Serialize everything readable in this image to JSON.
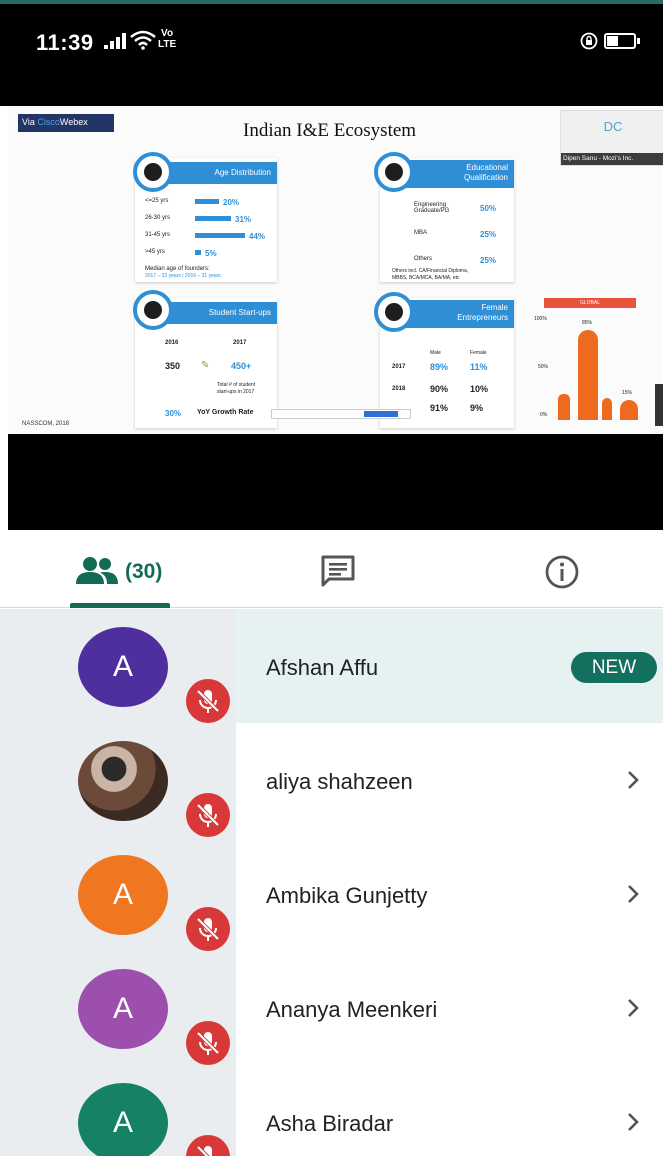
{
  "status_bar": {
    "time": "11:39",
    "network_badge_top": "Vo",
    "network_badge_bottom": "LTE",
    "icons": [
      "signal-icon",
      "wifi-icon",
      "rotation-lock-icon",
      "battery-icon"
    ]
  },
  "slide": {
    "webex_tag_prefix": "Via ",
    "webex_tag_brand": "Cisco",
    "webex_tag_suffix": "Webex",
    "title": "Indian I&E Ecosystem",
    "presenter_initials": "DC",
    "presenter_name": "Dipen Sanu - Mozi's Inc.",
    "age_distribution": {
      "heading": "Age Distribution",
      "rows": [
        {
          "label": "<=25 yrs",
          "value": "20%"
        },
        {
          "label": "26-30 yrs",
          "value": "31%"
        },
        {
          "label": "31-45 yrs",
          "value": "44%"
        },
        {
          "label": ">45 yrs",
          "value": "5%"
        }
      ],
      "bar_fractions": [
        0.2,
        0.31,
        0.44,
        0.05
      ],
      "note": "Median age of founders:",
      "note2": "2017 – 32 years | 2016 – 31 years"
    },
    "educational": {
      "heading_line1": "Educational",
      "heading_line2": "Qualification",
      "rows": [
        {
          "label": "Engineering Graduate/PG",
          "value": "50%"
        },
        {
          "label": "MBA",
          "value": "25%"
        },
        {
          "label": "Others",
          "value": "25%"
        }
      ],
      "note": "Others incl. CA/Financial Diploma,",
      "note2": "MBBS, BCA/MCA, BA/MA, etc"
    },
    "startups": {
      "heading": "Student Start-ups",
      "year1": "2016",
      "year2": "2017",
      "value1": "350",
      "value2": "450+",
      "note": "Total # of student",
      "note2": "start-ups in 2017",
      "growth_value": "30%",
      "growth_label": "YoY Growth Rate"
    },
    "female": {
      "heading_line1": "Female",
      "heading_line2": "Entrepreneurs",
      "col_male": "Male",
      "col_female": "Female",
      "rows": [
        {
          "year": "2017",
          "male": "89%",
          "female": "11%"
        },
        {
          "year": "2018",
          "male": "90%",
          "female": "10%"
        },
        {
          "year": "",
          "male": "91%",
          "female": "9%"
        }
      ]
    },
    "mini_chart": {
      "header": "GLOBAL",
      "y_ticks": [
        "100%",
        "50%",
        "0%"
      ],
      "bar_labels": [
        "85%",
        "15%"
      ]
    },
    "source": "NASSCOM, 2018"
  },
  "tabs": {
    "participants_count": "(30)",
    "icons": [
      "participants-icon",
      "chat-icon",
      "info-icon"
    ]
  },
  "participants": [
    {
      "initial": "A",
      "name": "Afshan Affu",
      "badge": "NEW",
      "color": "#4f2f9e",
      "has_photo": false
    },
    {
      "initial": "",
      "name": "aliya shahzeen",
      "badge": "",
      "color": "#6b4a3a",
      "has_photo": true
    },
    {
      "initial": "A",
      "name": "Ambika Gunjetty",
      "badge": "",
      "color": "#ee7720",
      "has_photo": false
    },
    {
      "initial": "A",
      "name": "Ananya Meenkeri",
      "badge": "",
      "color": "#9c4fad",
      "has_photo": false
    },
    {
      "initial": "A",
      "name": "Asha Biradar",
      "badge": "",
      "color": "#158266",
      "has_photo": false
    }
  ]
}
